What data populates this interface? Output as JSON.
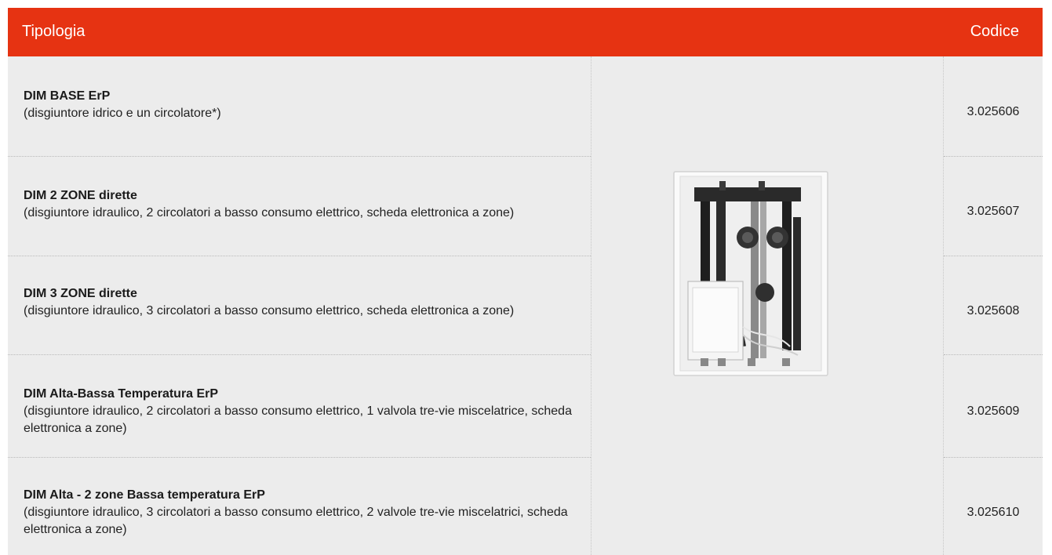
{
  "header": {
    "col_tipologia": "Tipologia",
    "col_codice": "Codice"
  },
  "rows": [
    {
      "title": "DIM BASE ErP",
      "desc": "(disgiuntore idrico e un circolatore*)",
      "code": "3.025606"
    },
    {
      "title": "DIM 2 ZONE dirette",
      "desc": "(disgiuntore idraulico, 2 circolatori a basso consumo elettrico, scheda elettronica a zone)",
      "code": "3.025607"
    },
    {
      "title": "DIM 3 ZONE dirette",
      "desc": "(disgiuntore idraulico, 3 circolatori a basso consumo elettrico, scheda elettronica a zone)",
      "code": "3.025608"
    },
    {
      "title": "DIM Alta-Bassa Temperatura ErP",
      "desc": "(disgiuntore idraulico, 2 circolatori a basso consumo elettrico, 1 valvola tre-vie miscelatrice, scheda elettronica a zone)",
      "code": "3.025609"
    },
    {
      "title": "DIM Alta - 2 zone Bassa temperatura ErP",
      "desc": "(disgiuntore idraulico, 3 circolatori a basso consumo elettrico, 2 valvole tre-vie miscelatrici, scheda elettronica a zone)",
      "code": "3.025610"
    }
  ],
  "image": {
    "icon": "hydraulic-manifold-unit-image"
  }
}
